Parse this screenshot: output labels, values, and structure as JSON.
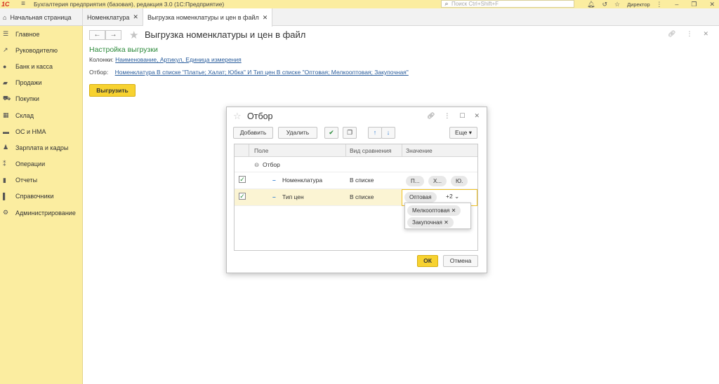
{
  "titlebar": {
    "logo": "1С",
    "title": "Бухгалтерия предприятия (базовая), редакция 3.0  (1С:Предприятие)",
    "search_placeholder": "Поиск Ctrl+Shift+F",
    "user": "Директор"
  },
  "tabs": {
    "home": "Начальная страница",
    "items": [
      {
        "label": "Номенклатура"
      },
      {
        "label": "Выгрузка номенклатуры и цен в файл"
      }
    ]
  },
  "sidebar": {
    "items": [
      {
        "label": "Главное",
        "icon": "menu-icon"
      },
      {
        "label": "Руководителю",
        "icon": "chart-icon"
      },
      {
        "label": "Банк и касса",
        "icon": "coin-icon"
      },
      {
        "label": "Продажи",
        "icon": "bag-icon"
      },
      {
        "label": "Покупки",
        "icon": "cart-icon"
      },
      {
        "label": "Склад",
        "icon": "warehouse-icon"
      },
      {
        "label": "ОС и НМА",
        "icon": "truck-icon"
      },
      {
        "label": "Зарплата и кадры",
        "icon": "person-icon"
      },
      {
        "label": "Операции",
        "icon": "operations-icon"
      },
      {
        "label": "Отчеты",
        "icon": "bar-chart-icon"
      },
      {
        "label": "Справочники",
        "icon": "book-icon"
      },
      {
        "label": "Администрирование",
        "icon": "gear-icon"
      }
    ]
  },
  "main": {
    "title": "Выгрузка номенклатуры и цен в файл",
    "settings_title": "Настройка выгрузки",
    "columns_label": "Колонки:",
    "columns_value": "Наименование, Артикул, Единица измерения",
    "filter_label": "Отбор:",
    "filter_value": "Номенклатура В списке \"Платье; Халат; Юбка\" И Тип цен В списке \"Оптовая; Мелкооптовая; Закупочная\"",
    "export_button": "Выгрузить"
  },
  "dialog": {
    "title": "Отбор",
    "add_button": "Добавить",
    "delete_button": "Удалить",
    "more_button": "Еще",
    "columns": {
      "field": "Поле",
      "comparison": "Вид сравнения",
      "value": "Значение"
    },
    "group_label": "Отбор",
    "rows": [
      {
        "field": "Номенклатура",
        "comparison": "В списке",
        "values": [
          "П...",
          "Х...",
          "Ю."
        ]
      },
      {
        "field": "Тип цен",
        "comparison": "В списке",
        "value": "Оптовая",
        "more": "+2"
      }
    ],
    "popup_values": [
      "Мелкооптовая",
      "Закупочная"
    ],
    "ok_button": "ОК",
    "cancel_button": "Отмена"
  },
  "colors": {
    "sidebar_bg": "#fbeda0",
    "accent_yellow": "#f7d230",
    "green_title": "#2d8a3c",
    "link_blue": "#2a5d9c"
  }
}
